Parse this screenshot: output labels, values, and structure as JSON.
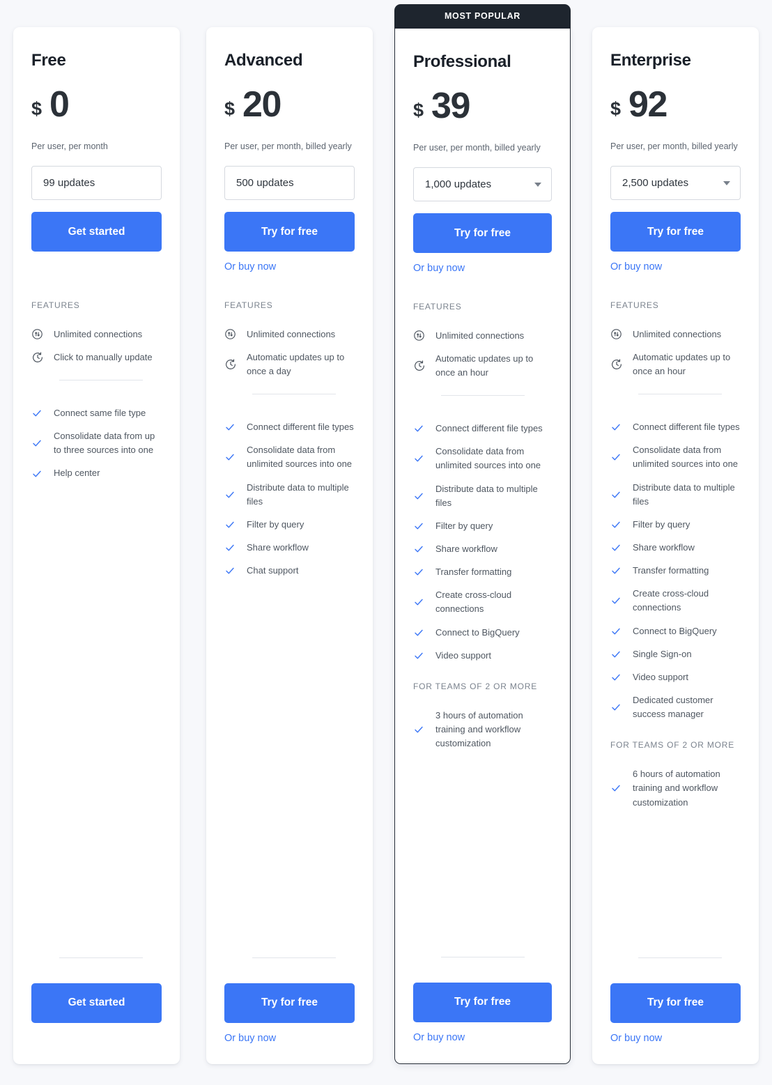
{
  "theme": {
    "accent_blue": "#3b76f6",
    "banner_dark": "#1e252e",
    "page_background": "#f7f8fb"
  },
  "labels": {
    "features_heading": "FEATURES",
    "teams_heading": "FOR TEAMS OF 2 OR MORE",
    "most_popular": "MOST POPULAR"
  },
  "plans": [
    {
      "name": "Free",
      "currency": "$",
      "amount": "0",
      "billing_note": "Per user, per month",
      "updates_value": "99 updates",
      "has_dropdown": false,
      "cta_label": "Get started",
      "buy_now_label": "Or buy now",
      "show_buy_now": false,
      "featured": false,
      "icon_features": [
        {
          "icon": "sync-arrows-icon",
          "text": "Unlimited connections"
        },
        {
          "icon": "clock-refresh-icon",
          "text": "Click to manually update"
        }
      ],
      "check_features": [
        "Connect same file type",
        "Consolidate data from up to three sources into one",
        "Help center"
      ],
      "teams_features": []
    },
    {
      "name": "Advanced",
      "currency": "$",
      "amount": "20",
      "billing_note": "Per user, per month, billed yearly",
      "updates_value": "500 updates",
      "has_dropdown": false,
      "cta_label": "Try for free",
      "buy_now_label": "Or buy now",
      "show_buy_now": true,
      "featured": false,
      "icon_features": [
        {
          "icon": "sync-arrows-icon",
          "text": "Unlimited connections"
        },
        {
          "icon": "clock-refresh-icon",
          "text": "Automatic updates up to once a day"
        }
      ],
      "check_features": [
        "Connect different file types",
        "Consolidate data from unlimited sources into one",
        "Distribute data to multiple files",
        "Filter by query",
        "Share workflow",
        "Chat support"
      ],
      "teams_features": []
    },
    {
      "name": "Professional",
      "currency": "$",
      "amount": "39",
      "billing_note": "Per user, per month, billed yearly",
      "updates_value": "1,000 updates",
      "has_dropdown": true,
      "cta_label": "Try for free",
      "buy_now_label": "Or buy now",
      "show_buy_now": true,
      "featured": true,
      "icon_features": [
        {
          "icon": "sync-arrows-icon",
          "text": "Unlimited connections"
        },
        {
          "icon": "clock-refresh-icon",
          "text": "Automatic updates up to once an hour"
        }
      ],
      "check_features": [
        "Connect different file types",
        "Consolidate data from unlimited sources into one",
        "Distribute data to multiple files",
        "Filter by query",
        "Share workflow",
        "Transfer formatting",
        "Create cross-cloud connections",
        "Connect to BigQuery",
        "Video support"
      ],
      "teams_features": [
        "3 hours of automation training and workflow customization"
      ]
    },
    {
      "name": "Enterprise",
      "currency": "$",
      "amount": "92",
      "billing_note": "Per user, per month, billed yearly",
      "updates_value": "2,500 updates",
      "has_dropdown": true,
      "cta_label": "Try for free",
      "buy_now_label": "Or buy now",
      "show_buy_now": true,
      "featured": false,
      "icon_features": [
        {
          "icon": "sync-arrows-icon",
          "text": "Unlimited connections"
        },
        {
          "icon": "clock-refresh-icon",
          "text": "Automatic updates up to once an hour"
        }
      ],
      "check_features": [
        "Connect different file types",
        "Consolidate data from unlimited sources into one",
        "Distribute data to multiple files",
        "Filter by query",
        "Share workflow",
        "Transfer formatting",
        "Create cross-cloud connections",
        "Connect to BigQuery",
        "Single Sign-on",
        "Video support",
        "Dedicated customer success manager"
      ],
      "teams_features": [
        "6 hours of automation training and workflow customization"
      ]
    }
  ]
}
